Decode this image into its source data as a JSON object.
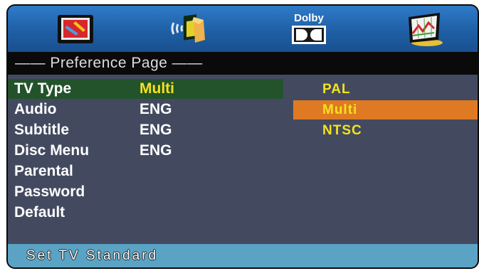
{
  "icons": {
    "general": "tv-setup-icon",
    "audio": "audio-speaker-icon",
    "dolby": "dolby-icon",
    "preference": "preference-chart-icon",
    "dolby_label": "Dolby"
  },
  "title": "——  Preference Page  ——",
  "menu": [
    {
      "label": "TV Type",
      "value": "Multi"
    },
    {
      "label": "Audio",
      "value": "ENG"
    },
    {
      "label": "Subtitle",
      "value": "ENG"
    },
    {
      "label": "Disc Menu",
      "value": "ENG"
    },
    {
      "label": "Parental",
      "value": ""
    },
    {
      "label": "Password",
      "value": ""
    },
    {
      "label": "Default",
      "value": ""
    }
  ],
  "options": [
    "PAL",
    "Multi",
    "NTSC"
  ],
  "status": "Set TV Standard",
  "colors": {
    "iconbar": "#1f5fa5",
    "background": "#434a60",
    "selected_row": "#23532b",
    "selected_option": "#e07a22",
    "highlight_text": "#f5e21c",
    "statusbar": "#5aa3c4"
  }
}
